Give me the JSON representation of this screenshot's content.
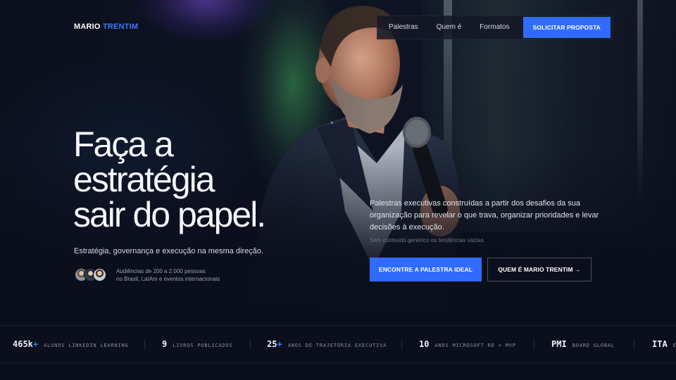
{
  "brand": {
    "first": "MARIO",
    "last": "TRENTIM"
  },
  "nav": {
    "items": [
      "Palestras",
      "Quem é",
      "Formatos"
    ],
    "cta": "SOLICITAR PROPOSTA"
  },
  "hero": {
    "headline": [
      "Faça a",
      "estratégia",
      "sair do papel."
    ],
    "subhead": "Estratégia, governança e execução na mesma direção.",
    "audience": [
      "Audiências de 200 a 2.000 pessoas",
      "no Brasil, LatAm e eventos internacionais"
    ],
    "description": "Palestras executivas construídas a partir dos desafios da sua organização para revelar o que trava, organizar prioridades e levar decisões à execução.",
    "note": "Sem conteúdo genérico ou tendências vazias.",
    "primary_cta": "ENCONTRE A PALESTRA IDEAL",
    "secondary_cta": "QUEM É MARIO TRENTIM →"
  },
  "stats": [
    {
      "value": "465k",
      "suffix": "+",
      "label": "ALUNOS LINKEDIN LEARNING"
    },
    {
      "value": "9",
      "suffix": "",
      "label": "LIVROS PUBLICADOS"
    },
    {
      "value": "25",
      "suffix": "+",
      "label": "ANOS DE TRAJETÓRIA EXECUTIVA"
    },
    {
      "value": "10",
      "suffix": "",
      "label": "ANOS MICROSOFT RD + MVP"
    },
    {
      "value": "PMI",
      "suffix": "",
      "label": "BOARD GLOBAL"
    },
    {
      "value": "ITA",
      "suffix": "",
      "label": "E"
    }
  ],
  "colors": {
    "accent": "#2f6bff",
    "background": "#0b0f1c"
  }
}
